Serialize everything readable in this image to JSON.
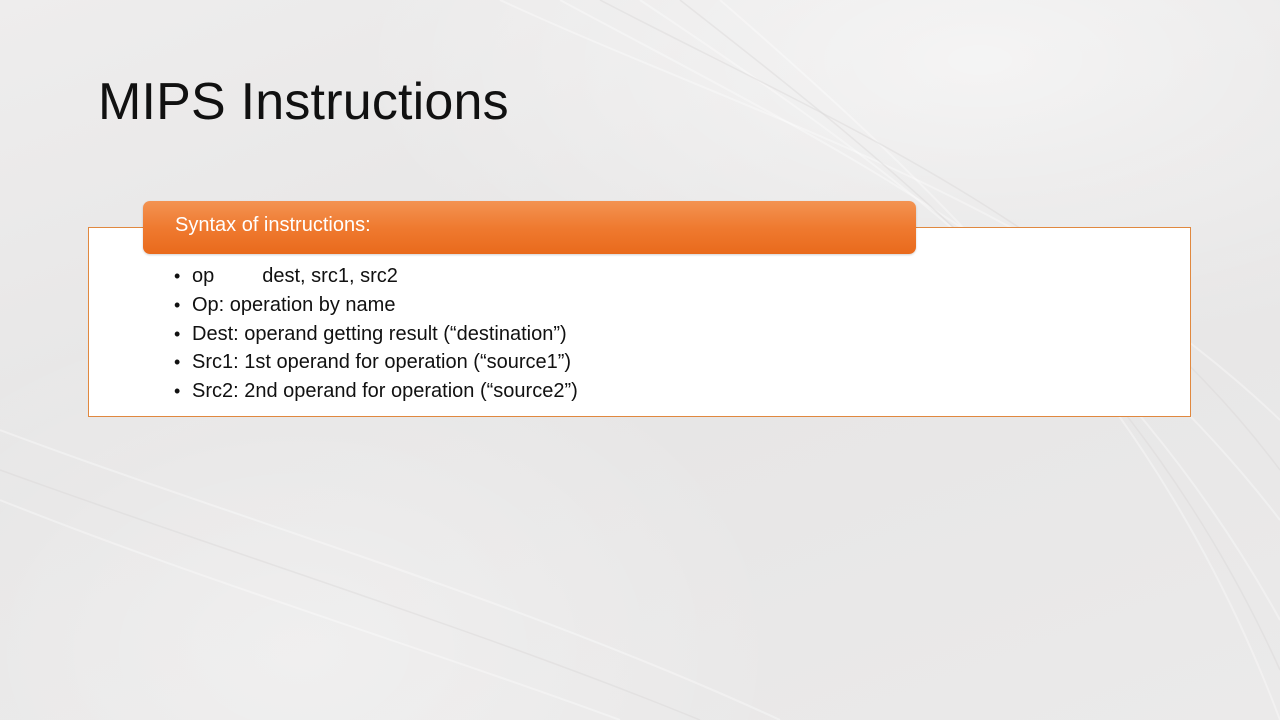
{
  "slide": {
    "title": "MIPS Instructions",
    "header": "Syntax of instructions:",
    "bullet_glyph": "•",
    "syntax_line": {
      "op": "op",
      "operands": "dest, src1, src2"
    },
    "bullets": [
      "Op: operation by name",
      "Dest: operand getting result (“destination”)",
      "Src1: 1st operand for operation (“source1”)",
      "Src2: 2nd operand for operation (“source2”)"
    ]
  },
  "colors": {
    "accent": "#ef7a30",
    "border": "#e0883f",
    "text": "#111111"
  }
}
